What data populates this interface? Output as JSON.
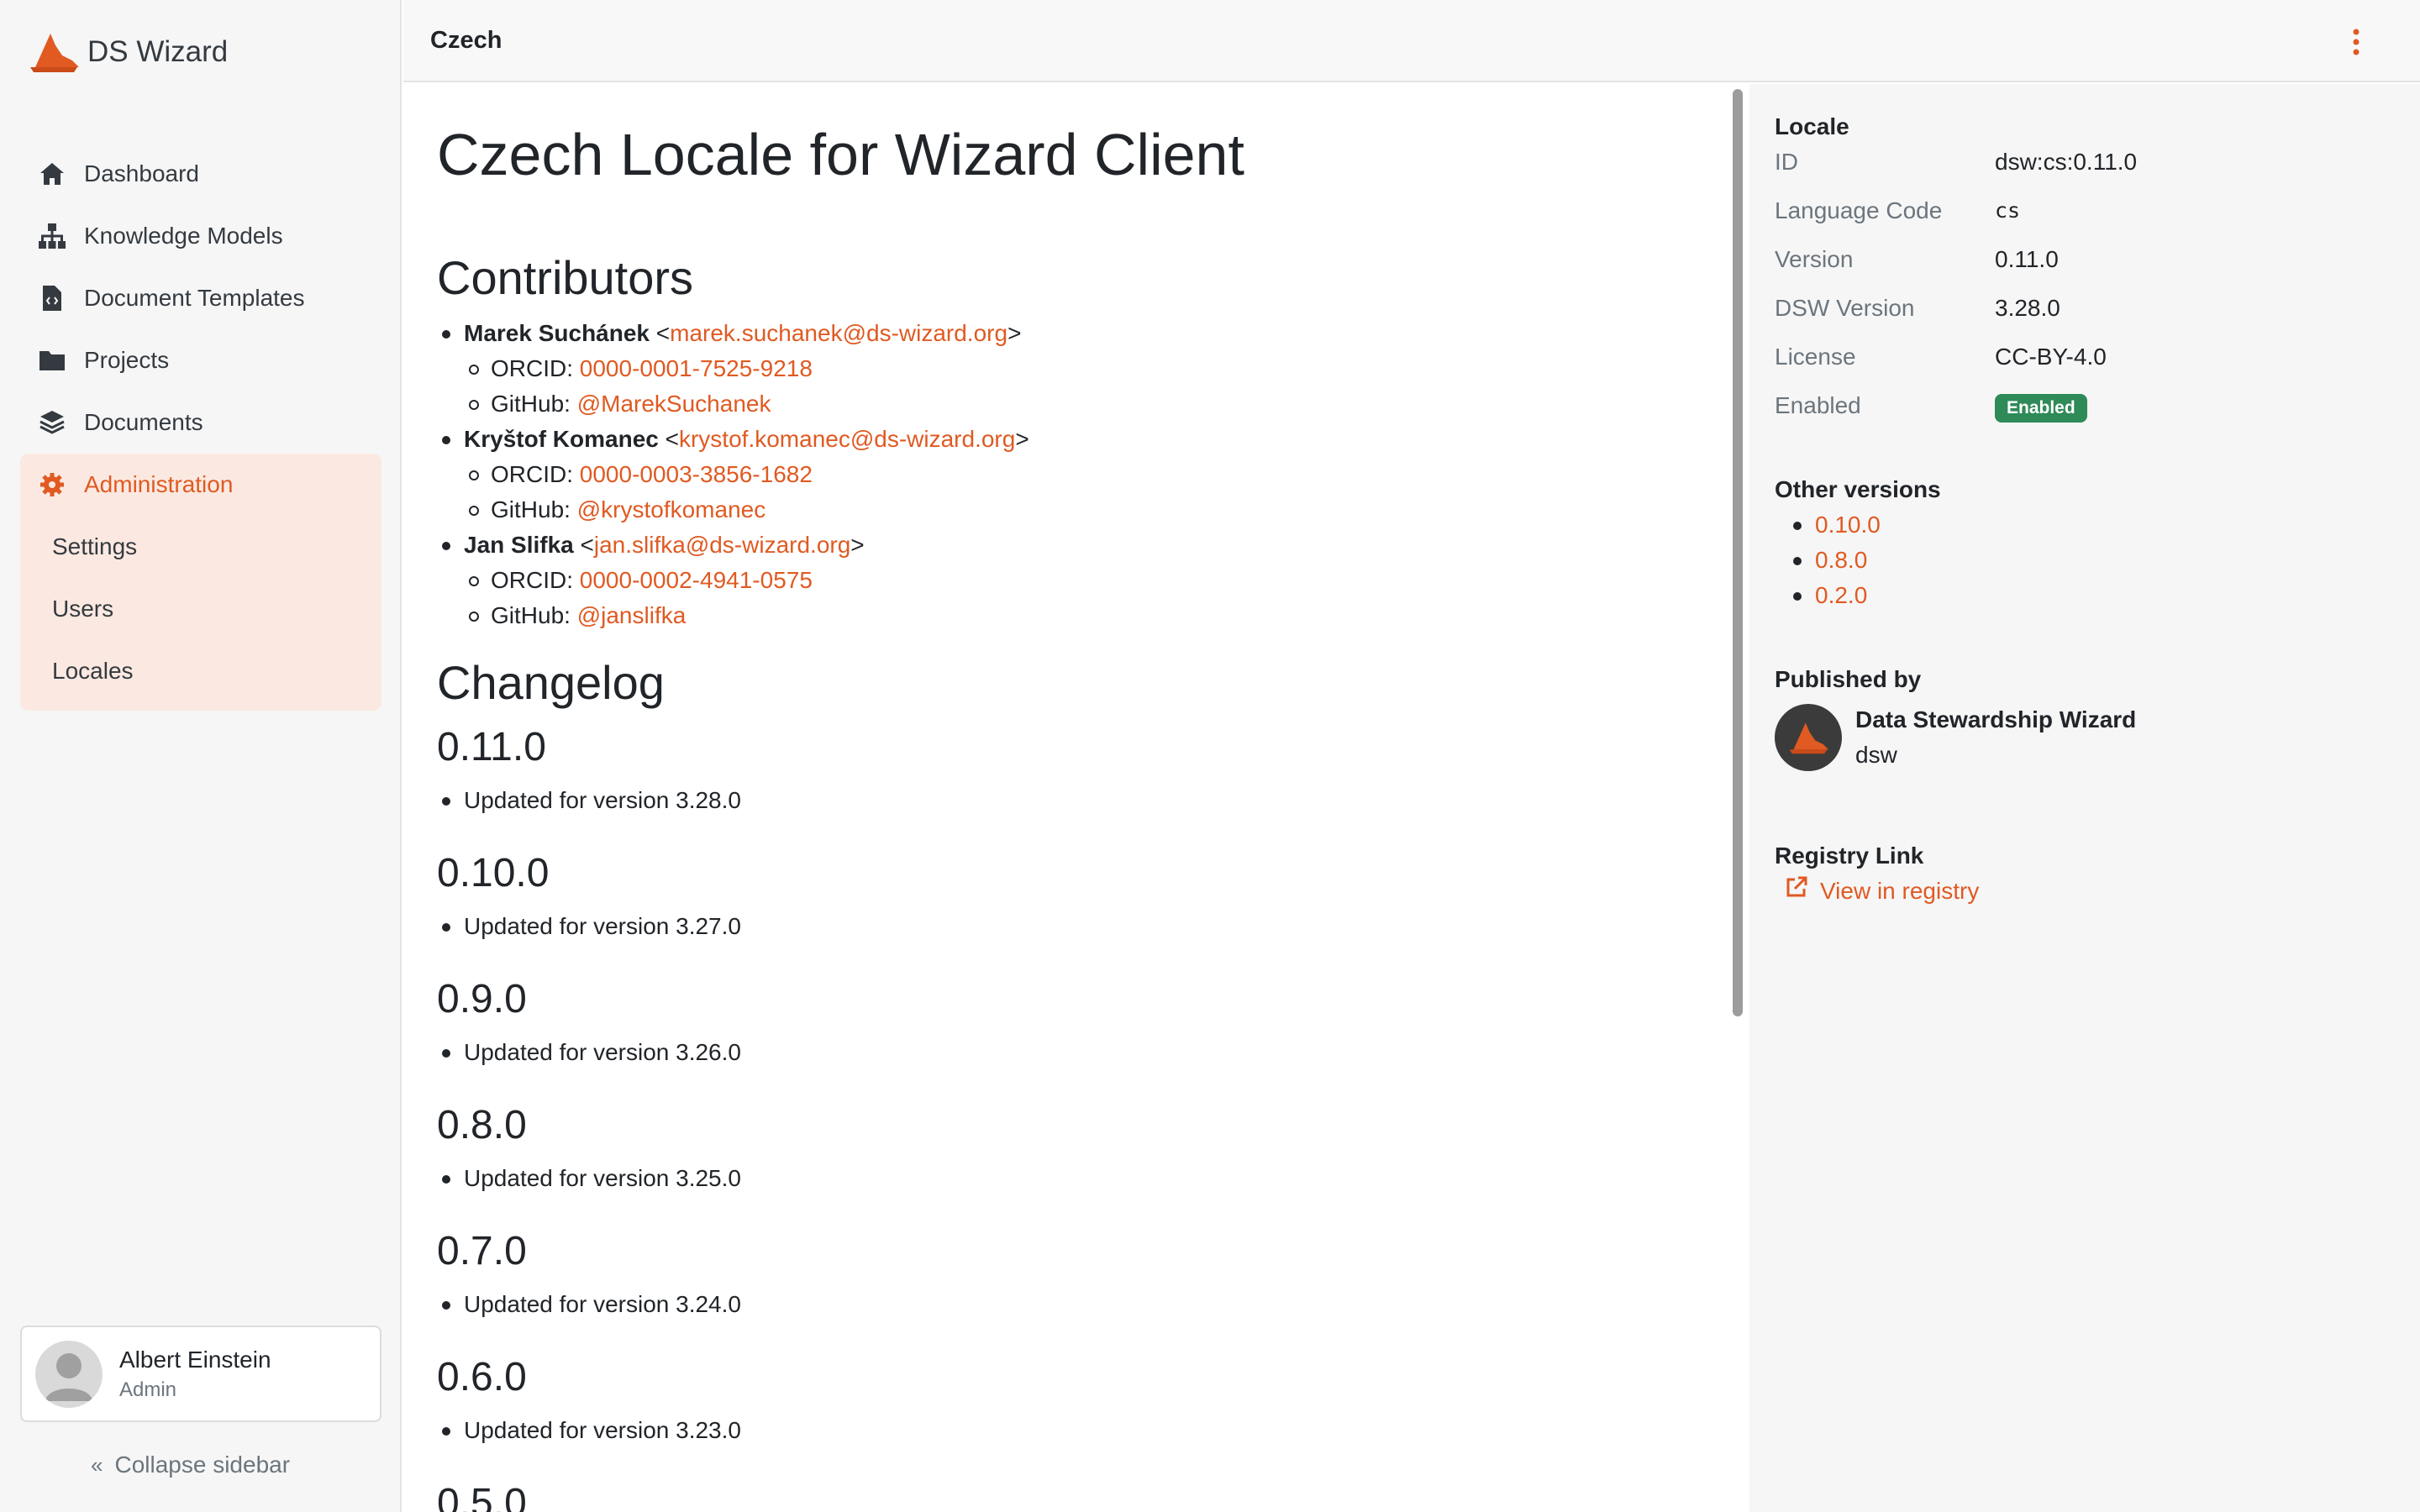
{
  "app": {
    "name": "DS Wizard",
    "logo_icon": "wizard-hat-icon",
    "accent_color": "#e05a22"
  },
  "sidebar": {
    "items": [
      {
        "label": "Dashboard",
        "icon": "home-icon"
      },
      {
        "label": "Knowledge Models",
        "icon": "sitemap-icon"
      },
      {
        "label": "Document Templates",
        "icon": "file-code-icon"
      },
      {
        "label": "Projects",
        "icon": "folder-icon"
      },
      {
        "label": "Documents",
        "icon": "layers-icon"
      }
    ],
    "admin": {
      "label": "Administration",
      "icon": "gear-icon",
      "subitems": [
        "Settings",
        "Users",
        "Locales"
      ]
    },
    "user": {
      "name": "Albert Einstein",
      "role": "Admin"
    },
    "collapse_label": "Collapse sidebar"
  },
  "topbar": {
    "title": "Czech"
  },
  "main": {
    "title": "Czech Locale for Wizard Client",
    "contributors_heading": "Contributors",
    "contributors": [
      {
        "name": "Marek Suchánek",
        "email": "marek.suchanek@ds-wizard.org",
        "orcid_label": "ORCID:",
        "orcid": "0000-0001-7525-9218",
        "github_label": "GitHub:",
        "github": "@MarekSuchanek"
      },
      {
        "name": "Kryštof Komanec",
        "email": "krystof.komanec@ds-wizard.org",
        "orcid_label": "ORCID:",
        "orcid": "0000-0003-3856-1682",
        "github_label": "GitHub:",
        "github": "@krystofkomanec"
      },
      {
        "name": "Jan Slifka",
        "email": "jan.slifka@ds-wizard.org",
        "orcid_label": "ORCID:",
        "orcid": "0000-0002-4941-0575",
        "github_label": "GitHub:",
        "github": "@janslifka"
      }
    ],
    "changelog_heading": "Changelog",
    "changelog": [
      {
        "version": "0.11.0",
        "change": "Updated for version 3.28.0"
      },
      {
        "version": "0.10.0",
        "change": "Updated for version 3.27.0"
      },
      {
        "version": "0.9.0",
        "change": "Updated for version 3.26.0"
      },
      {
        "version": "0.8.0",
        "change": "Updated for version 3.25.0"
      },
      {
        "version": "0.7.0",
        "change": "Updated for version 3.24.0"
      },
      {
        "version": "0.6.0",
        "change": "Updated for version 3.23.0"
      },
      {
        "version": "0.5.0",
        "change": ""
      }
    ]
  },
  "panel": {
    "locale_heading": "Locale",
    "rows": [
      {
        "key": "ID",
        "value": "dsw:cs:0.11.0"
      },
      {
        "key": "Language Code",
        "value": "cs"
      },
      {
        "key": "Version",
        "value": "0.11.0"
      },
      {
        "key": "DSW Version",
        "value": "3.28.0"
      },
      {
        "key": "License",
        "value": "CC-BY-4.0"
      },
      {
        "key": "Enabled",
        "value": "Enabled"
      }
    ],
    "other_versions_heading": "Other versions",
    "other_versions": [
      "0.10.0",
      "0.8.0",
      "0.2.0"
    ],
    "published_by_heading": "Published by",
    "publisher": {
      "name": "Data Stewardship Wizard",
      "id": "dsw"
    },
    "registry_heading": "Registry Link",
    "registry_link": "View in registry",
    "badge_color": "#2e8a57"
  }
}
